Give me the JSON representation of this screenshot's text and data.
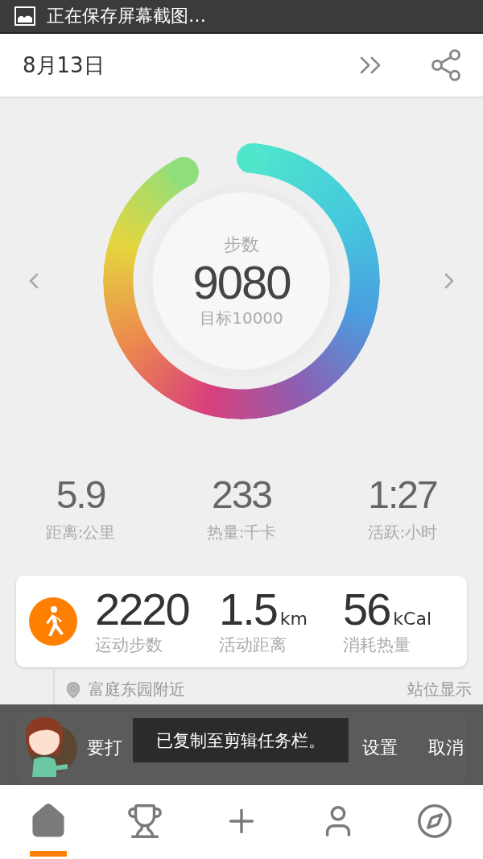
{
  "status_bar": {
    "notification": "正在保存屏幕截图…"
  },
  "header": {
    "date": "8月13日"
  },
  "steps": {
    "label": "步数",
    "value": "9080",
    "goal": "目标10000"
  },
  "summary": [
    {
      "value": "5.9",
      "label": "距离:公里"
    },
    {
      "value": "233",
      "label": "热量:千卡"
    },
    {
      "value": "1:27",
      "label": "活跃:小时"
    }
  ],
  "activities": [
    {
      "steps": "2220",
      "steps_label": "运动步数",
      "distance": "1.5",
      "distance_unit": "km",
      "distance_label": "活动距离",
      "calories": "56",
      "calories_unit": "kCal",
      "calories_label": "消耗热量"
    }
  ],
  "location": {
    "place": "富庭东园附近",
    "action": "站位显示"
  },
  "prompt": {
    "text": "要打",
    "buttons": [
      "设置",
      "取消"
    ]
  },
  "toast": {
    "text": "已复制至剪辑任务栏。"
  },
  "tabs": [
    {
      "kind": "home",
      "selected": true
    },
    {
      "kind": "trophy",
      "selected": false
    },
    {
      "kind": "add",
      "selected": false
    },
    {
      "kind": "profile",
      "selected": false
    },
    {
      "kind": "discover",
      "selected": false
    }
  ]
}
